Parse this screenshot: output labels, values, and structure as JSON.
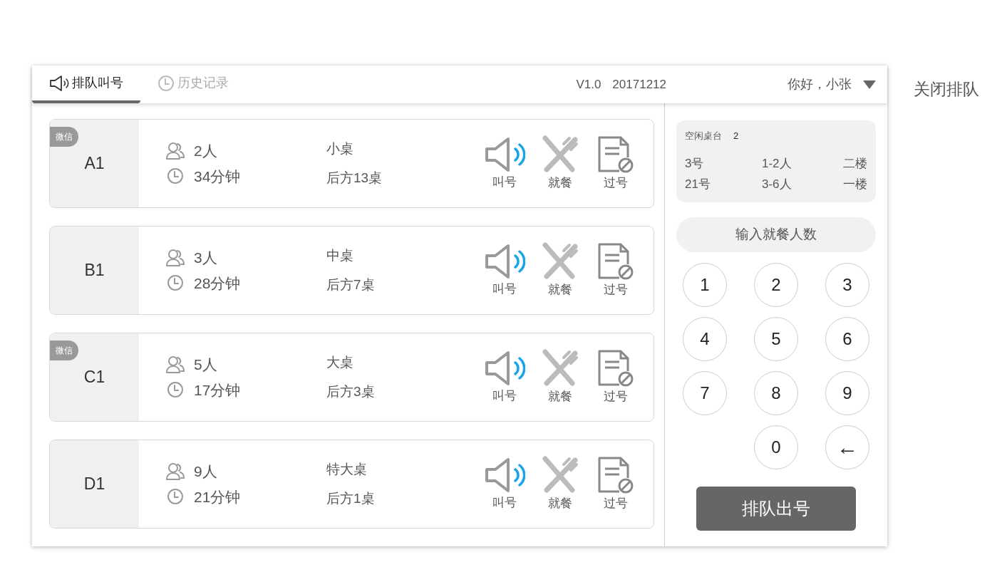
{
  "tabs": [
    {
      "label": "排队叫号",
      "kind": "calling",
      "selected": true
    },
    {
      "label": "历史记录",
      "kind": "history",
      "selected": false
    }
  ],
  "version": "V1.0",
  "build": "20171212",
  "user": "你好，小张",
  "close_queue": "关闭排队",
  "queue": [
    {
      "number": "A1",
      "tag": "微信",
      "people": "2人",
      "wait": "34分钟",
      "table_size": "小桌",
      "ahead": "后方13桌",
      "actions": [
        {
          "kind": "call",
          "label": "叫号"
        },
        {
          "kind": "seat",
          "label": "就餐"
        },
        {
          "kind": "skip",
          "label": "过号"
        }
      ]
    },
    {
      "number": "B1",
      "people": "3人",
      "wait": "28分钟",
      "table_size": "中桌",
      "ahead": "后方7桌",
      "actions": [
        {
          "kind": "call",
          "label": "叫号"
        },
        {
          "kind": "seat",
          "label": "就餐"
        },
        {
          "kind": "skip",
          "label": "过号"
        }
      ]
    },
    {
      "number": "C1",
      "tag": "微信",
      "people": "5人",
      "wait": "17分钟",
      "table_size": "大桌",
      "ahead": "后方3桌",
      "actions": [
        {
          "kind": "call",
          "label": "叫号"
        },
        {
          "kind": "seat",
          "label": "就餐"
        },
        {
          "kind": "skip",
          "label": "过号"
        }
      ]
    },
    {
      "number": "D1",
      "people": "9人",
      "wait": "21分钟",
      "table_size": "特大桌",
      "ahead": "后方1桌",
      "actions": [
        {
          "kind": "call",
          "label": "叫号"
        },
        {
          "kind": "seat",
          "label": "就餐"
        },
        {
          "kind": "skip",
          "label": "过号"
        }
      ]
    }
  ],
  "free_tables": {
    "label": "空闲桌台",
    "count": "2",
    "rows": [
      {
        "number": "3号",
        "capacity": "1-2人",
        "floor": "二楼"
      },
      {
        "number": "21号",
        "capacity": "3-6人",
        "floor": "一楼"
      }
    ]
  },
  "party_size_field": {
    "placeholder": "输入就餐人数"
  },
  "keypad": [
    {
      "kind": "digit",
      "label": "1"
    },
    {
      "kind": "digit",
      "label": "2"
    },
    {
      "kind": "digit",
      "label": "3"
    },
    {
      "kind": "digit",
      "label": "4"
    },
    {
      "kind": "digit",
      "label": "5"
    },
    {
      "kind": "digit",
      "label": "6"
    },
    {
      "kind": "digit",
      "label": "7"
    },
    {
      "kind": "digit",
      "label": "8"
    },
    {
      "kind": "digit",
      "label": "9"
    },
    {
      "kind": "spacer"
    },
    {
      "kind": "digit",
      "label": "0"
    },
    {
      "kind": "backspace",
      "label": "←"
    }
  ],
  "submit": "排队出号"
}
